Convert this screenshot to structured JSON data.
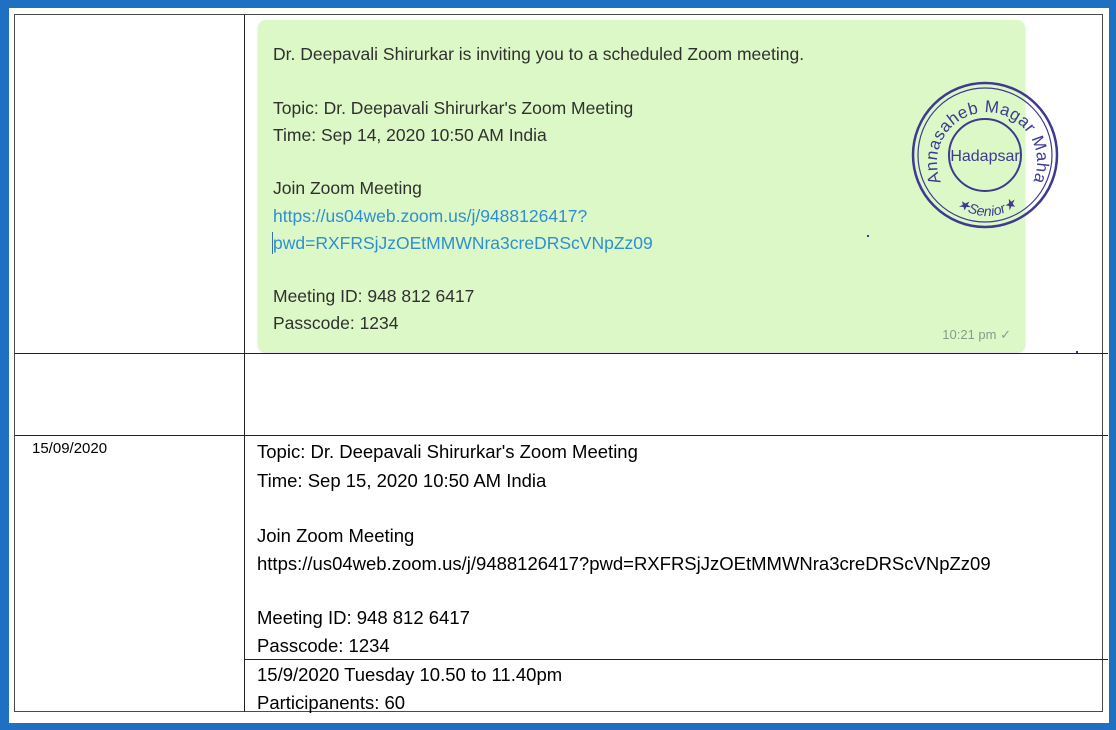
{
  "message": {
    "invite": "Dr. Deepavali Shirurkar is inviting you to a scheduled Zoom meeting.",
    "topic": "Topic: Dr. Deepavali Shirurkar's Zoom Meeting",
    "time": "Time: Sep 14, 2020 10:50 AM India",
    "join_label": "Join Zoom Meeting",
    "link_line1": "https://us04web.zoom.us/j/9488126417?",
    "link_line2": "pwd=RXFRSjJzOEtMMWNra3creDRScVNpZz09",
    "meeting_id": "Meeting ID: 948 812 6417",
    "passcode": "Passcode: 1234",
    "timestamp": "10:21 pm ✓"
  },
  "stamp": {
    "ring_text": "Annasaheb Magar Mahavidyalaya",
    "center_text": "Hadapsar",
    "bottom_text": "★Senior★"
  },
  "row2": {
    "date": "15/09/2020",
    "topic": "Topic: Dr. Deepavali Shirurkar's Zoom Meeting",
    "time": "Time: Sep 15, 2020 10:50 AM India",
    "join_label": "Join Zoom Meeting",
    "link": "https://us04web.zoom.us/j/9488126417?pwd=RXFRSjJzOEtMMWNra3creDRScVNpZz09",
    "meeting_id": "Meeting ID: 948 812 6417",
    "passcode": "Passcode: 1234",
    "schedule": "15/9/2020  Tuesday 10.50 to 11.40pm",
    "participants": "Participanents: 60"
  },
  "colors": {
    "frame": "#1f6fc2",
    "bubble": "#dcf8c6",
    "link": "#2f8fd0",
    "stamp": "#3d3a8f"
  }
}
